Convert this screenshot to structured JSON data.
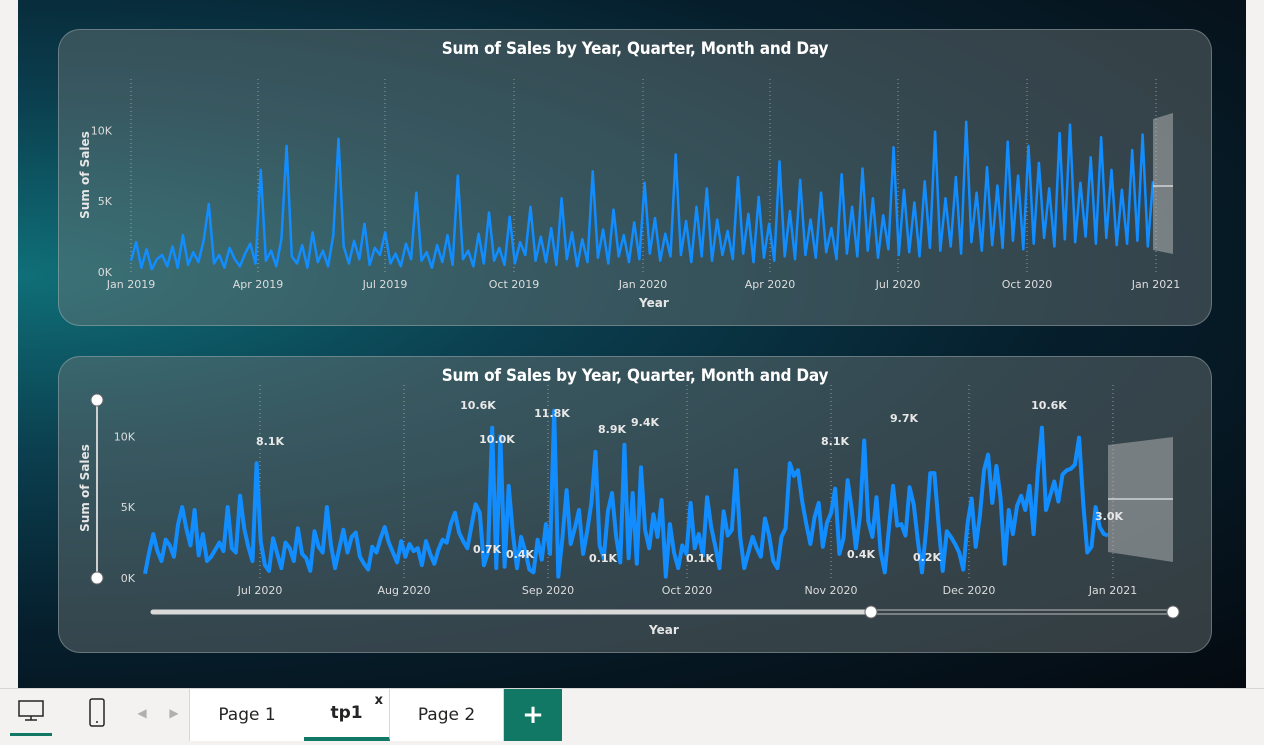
{
  "chart_data": [
    {
      "type": "line",
      "title": "Sum of Sales by Year, Quarter, Month and Day",
      "xlabel": "Year",
      "ylabel": "Sum of Sales",
      "x_ticks": [
        "Jan 2019",
        "Apr 2019",
        "Jul 2019",
        "Oct 2019",
        "Jan 2020",
        "Apr 2020",
        "Jul 2020",
        "Oct 2020",
        "Jan 2021"
      ],
      "y_ticks": [
        "0K",
        "5K",
        "10K"
      ],
      "ylim": [
        0,
        11500
      ],
      "grid": "vertical-dotted",
      "series": [
        {
          "values": [
            800,
            2100,
            300,
            1600,
            200,
            900,
            1200,
            400,
            1800,
            300,
            2600,
            500,
            1400,
            700,
            2200,
            4800,
            600,
            1200,
            300,
            1700,
            900,
            400,
            1300,
            2000,
            600,
            7200,
            800,
            1500,
            400,
            2300,
            8900,
            1100,
            600,
            1900,
            300,
            2800,
            700,
            1500,
            400,
            2600,
            9400,
            1800,
            600,
            2200,
            900,
            3400,
            500,
            1700,
            1200,
            2800,
            600,
            1300,
            400,
            2000,
            900,
            5600,
            800,
            1400,
            300,
            1900,
            700,
            2600,
            500,
            6800,
            900,
            1500,
            400,
            2700,
            600,
            4200,
            800,
            1700,
            500,
            3900,
            600,
            2100,
            1200,
            4600,
            800,
            2500,
            700,
            3100,
            500,
            5200,
            900,
            2800,
            400,
            2300,
            700,
            7100,
            1000,
            3000,
            600,
            4400,
            1100,
            2600,
            700,
            3500,
            900,
            6300,
            1300,
            3800,
            800,
            2700,
            1100,
            8300,
            1200,
            3600,
            700,
            4600,
            1100,
            5900,
            800,
            3700,
            1200,
            2900,
            900,
            6700,
            1300,
            4100,
            700,
            5300,
            1000,
            3400,
            800,
            7800,
            1100,
            4300,
            900,
            6500,
            1200,
            3700,
            1000,
            5600,
            1400,
            3100,
            900,
            6900,
            1300,
            4600,
            1100,
            7300,
            1500,
            5200,
            1000,
            4000,
            1600,
            8800,
            1200,
            5800,
            1400,
            4900,
            1100,
            6400,
            1700,
            9900,
            1500,
            5200,
            1800,
            6700,
            1300,
            10600,
            2100,
            5600,
            1500,
            7400,
            1900,
            6100,
            1700,
            9200,
            2200,
            6800,
            1600,
            8900,
            2000,
            7700,
            2400,
            5900,
            1800,
            9800,
            2300,
            10400,
            2100,
            6300,
            2500,
            8100,
            2000,
            9500,
            2400,
            7200,
            1900,
            5800,
            2000,
            8600,
            2200,
            9700,
            1800,
            6400
          ]
        }
      ]
    },
    {
      "type": "line",
      "title": "Sum of Sales by Year, Quarter, Month and Day",
      "xlabel": "Year",
      "ylabel": "Sum of Sales",
      "x_ticks": [
        "Jul 2020",
        "Aug 2020",
        "Sep 2020",
        "Oct 2020",
        "Nov 2020",
        "Dec 2020",
        "Jan 2021"
      ],
      "y_ticks": [
        "0K",
        "5K",
        "10K"
      ],
      "ylim": [
        0,
        11500
      ],
      "grid": "vertical-dotted",
      "data_labels": [
        "8.1K",
        "10.6K",
        "11.8K",
        "10.0K",
        "8.9K",
        "9.4K",
        "0.7K",
        "0.4K",
        "0.1K",
        "0.1K",
        "8.1K",
        "9.7K",
        "0.4K",
        "0.2K",
        "10.6K",
        "3.0K"
      ],
      "series": [
        {
          "values": [
            300,
            1800,
            3100,
            1900,
            1200,
            2700,
            2300,
            1500,
            3800,
            5000,
            3500,
            2300,
            4800,
            1600,
            3100,
            1200,
            1500,
            2000,
            2500,
            1900,
            5000,
            2100,
            1800,
            5800,
            3500,
            2200,
            1200,
            8100,
            2600,
            900,
            500,
            2800,
            1700,
            700,
            2500,
            2100,
            1200,
            3500,
            1700,
            1400,
            500,
            3300,
            2200,
            1800,
            5000,
            2300,
            700,
            2100,
            3400,
            1800,
            2900,
            3200,
            1500,
            1000,
            600,
            2200,
            1800,
            2800,
            3600,
            2500,
            1800,
            1100,
            2600,
            1500,
            2400,
            1900,
            2100,
            900,
            2600,
            1700,
            1000,
            2000,
            2700,
            2500,
            3800,
            4600,
            3200,
            2600,
            2100,
            3700,
            5200,
            4600,
            900,
            1800,
            10600,
            700,
            10000,
            800,
            6500,
            3200,
            700,
            2900,
            1900,
            600,
            400,
            2700,
            1300,
            3800,
            1700,
            11800,
            100,
            2800,
            6200,
            2400,
            3500,
            4800,
            1700,
            3300,
            5300,
            8900,
            2300,
            1400,
            4700,
            6000,
            2900,
            1100,
            9400,
            1400,
            6000,
            1000,
            7800,
            3400,
            2100,
            4500,
            2900,
            5500,
            100,
            3800,
            1800,
            700,
            2300,
            1700,
            5300,
            2100,
            3100,
            1600,
            5700,
            3600,
            2200,
            700,
            4700,
            3000,
            3400,
            7600,
            2900,
            700,
            1800,
            2900,
            2100,
            1500,
            4200,
            3000,
            1200,
            700,
            2900,
            3500,
            8100,
            7200,
            7600,
            5400,
            3800,
            2400,
            4300,
            5300,
            2200,
            3900,
            4600,
            6300,
            1700,
            2800,
            6900,
            4800,
            2100,
            4400,
            9700,
            4000,
            2900,
            5700,
            1800,
            400,
            3500,
            6500,
            3700,
            3800,
            3000,
            6400,
            5200,
            2600,
            400,
            3400,
            7400,
            7400,
            3800,
            500,
            3300,
            2900,
            2400,
            1800,
            600,
            3800,
            5600,
            2200,
            4400,
            7600,
            8700,
            5300,
            7900,
            5700,
            1000,
            4800,
            3100,
            5100,
            5800,
            4800,
            6500,
            3100,
            7400,
            10600,
            4800,
            5800,
            6800,
            5400,
            7300,
            7600,
            7700,
            8000,
            9900,
            5300,
            1800,
            2200,
            5000,
            3600,
            3100,
            3000
          ]
        }
      ],
      "range_slider": {
        "visible": true
      }
    }
  ],
  "tabs": {
    "items": [
      {
        "label": "Page 1"
      },
      {
        "label": "tp1",
        "active": true,
        "close": "x"
      },
      {
        "label": "Page 2"
      }
    ],
    "add_label": "+"
  },
  "colors": {
    "line": "#118dff",
    "tab_active": "#117865"
  },
  "icons": [
    "desktop-view-icon",
    "mobile-view-icon",
    "chevron-left-icon",
    "chevron-right-icon"
  ]
}
